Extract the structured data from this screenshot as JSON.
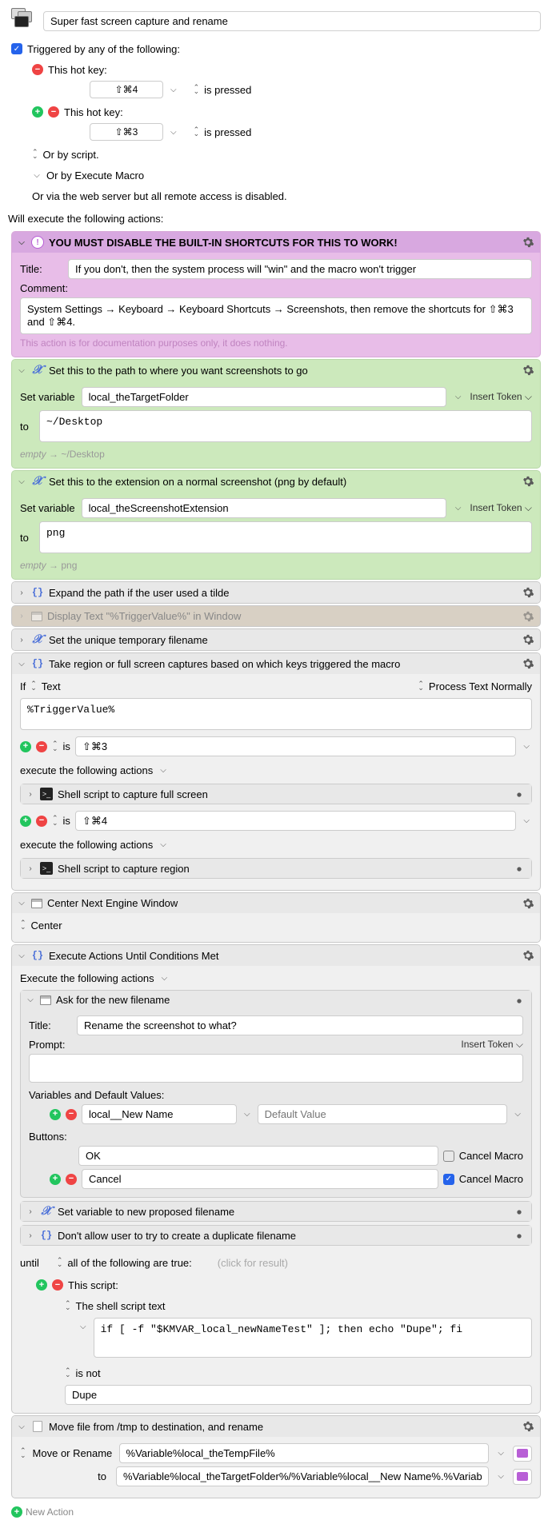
{
  "macroTitle": "Super fast screen capture and rename",
  "triggerHeader": "Triggered by any of the following:",
  "hotkey1": {
    "label": "This hot key:",
    "key": "⇧⌘4",
    "state": "is pressed"
  },
  "hotkey2": {
    "label": "This hot key:",
    "key": "⇧⌘3",
    "state": "is pressed"
  },
  "orScript": "Or by script.",
  "orExecMacro": "Or by Execute Macro",
  "orWeb": "Or via the web server but all remote access is disabled.",
  "willExecute": "Will execute the following actions:",
  "a1": {
    "title": "YOU MUST DISABLE THE BUILT-IN SHORTCUTS FOR THIS TO WORK!",
    "titleLbl": "Title:",
    "titleVal": "If you don't, then the system process will \"win\" and the macro won't trigger",
    "commentLbl": "Comment:",
    "commentVal": "System Settings → Keyboard → Keyboard Shortcuts → Screenshots, then remove the shortcuts for ⇧⌘3 and ⇧⌘4.",
    "note": "This action is for documentation purposes only, it does nothing."
  },
  "a2": {
    "title": "Set this to the path to where you want screenshots to go",
    "setVar": "Set variable",
    "varName": "local_theTargetFolder",
    "insertToken": "Insert Token",
    "toLbl": "to",
    "toVal": "~/Desktop",
    "hint1": "empty",
    "hint2": "~/Desktop"
  },
  "a3": {
    "title": "Set this to the extension on a normal screenshot (png by default)",
    "setVar": "Set variable",
    "varName": "local_theScreenshotExtension",
    "insertToken": "Insert Token",
    "toLbl": "to",
    "toVal": "png",
    "hint1": "empty",
    "hint2": "png"
  },
  "a4": {
    "title": "Expand the path if the user used a tilde"
  },
  "a5": {
    "title": "Display Text \"%TriggerValue%\" in Window"
  },
  "a6": {
    "title": "Set the unique temporary filename"
  },
  "a7": {
    "title": "Take region or full screen captures based on which keys triggered the macro",
    "ifLbl": "If",
    "textLbl": "Text",
    "procLbl": "Process Text Normally",
    "trigVal": "%TriggerValue%",
    "isLbl": "is",
    "val1": "⇧⌘3",
    "val2": "⇧⌘4",
    "execLbl": "execute the following actions",
    "shell1": "Shell script to capture full screen",
    "shell2": "Shell script to capture region"
  },
  "a8": {
    "title": "Center Next Engine Window",
    "centerLbl": "Center"
  },
  "a9": {
    "title": "Execute Actions Until Conditions Met",
    "execLbl": "Execute the following actions",
    "ask": {
      "title": "Ask for the new filename",
      "titleLbl": "Title:",
      "titleVal": "Rename the screenshot to what?",
      "promptLbl": "Prompt:",
      "insertToken": "Insert Token",
      "varsLbl": "Variables and Default Values:",
      "varName": "local__New Name",
      "defPlaceholder": "Default Value",
      "btnsLbl": "Buttons:",
      "btn1": "OK",
      "btn2": "Cancel",
      "cancelMacro": "Cancel Macro"
    },
    "sub2": "Set variable to new proposed filename",
    "sub3": "Don't allow user to try to create a duplicate filename",
    "untilLbl": "until",
    "allTrue": "all of the following are true:",
    "clickRes": "(click for result)",
    "scriptLbl": "This script:",
    "shellTextLbl": "The shell script text",
    "shellCode": "if [ -f \"$KMVAR_local_newNameTest\" ]; then echo \"Dupe\"; fi",
    "isNotLbl": "is not",
    "dupeVal": "Dupe"
  },
  "a10": {
    "title": "Move file from /tmp to destination, and rename",
    "moveLbl": "Move or Rename",
    "src": "%Variable%local_theTempFile%",
    "toLbl": "to",
    "dst": "%Variable%local_theTargetFolder%/%Variable%local__New Name%.%Variable%local_the"
  },
  "newAction": "New Action"
}
